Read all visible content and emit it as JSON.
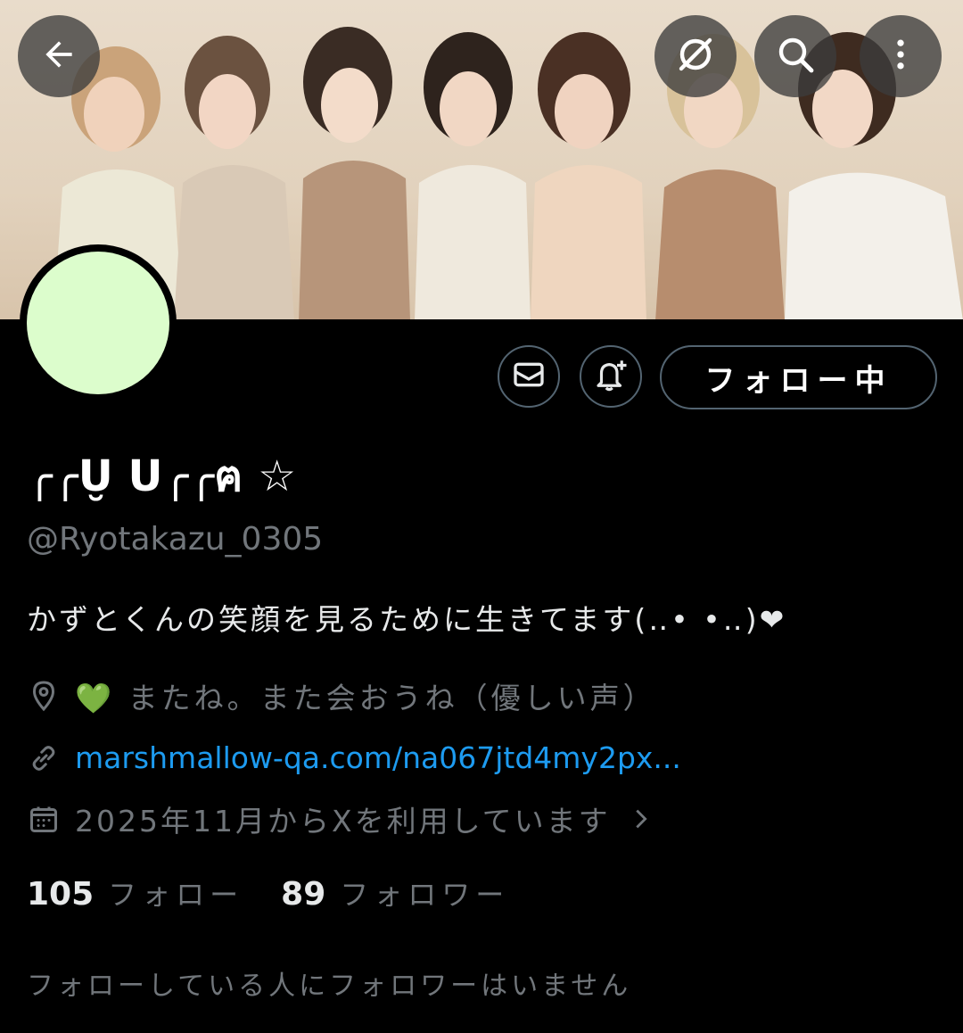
{
  "header": {
    "back_icon": "arrow-left-icon",
    "grok_icon": "grok-icon",
    "search_icon": "search-icon",
    "more_icon": "more-vertical-icon"
  },
  "profile": {
    "display_name": "╭╭U̮ U╭╭ฅ ☆",
    "handle": "@Ryotakazu_0305",
    "bio": "かずとくんの笑顔を見るために生きてます(‥• •‥)❤",
    "location": "💚 またね。また会おうね（優しい声）",
    "website": "marshmallow-qa.com/na067jtd4my2px...",
    "joined": "2025年11月からXを利用しています",
    "avatar_color": "#dcfdcc"
  },
  "actions": {
    "message_icon": "envelope-icon",
    "notify_icon": "bell-plus-icon",
    "follow_label": "フォロー中"
  },
  "stats": {
    "following_count": "105",
    "following_label": "フォロー",
    "followers_count": "89",
    "followers_label": "フォロワー"
  },
  "mutual_note": "フォローしている人にフォロワーはいません",
  "colors": {
    "background": "#000000",
    "text": "#e7e9ea",
    "secondary": "#71767b",
    "link": "#1d9bf0",
    "border": "#536471"
  }
}
